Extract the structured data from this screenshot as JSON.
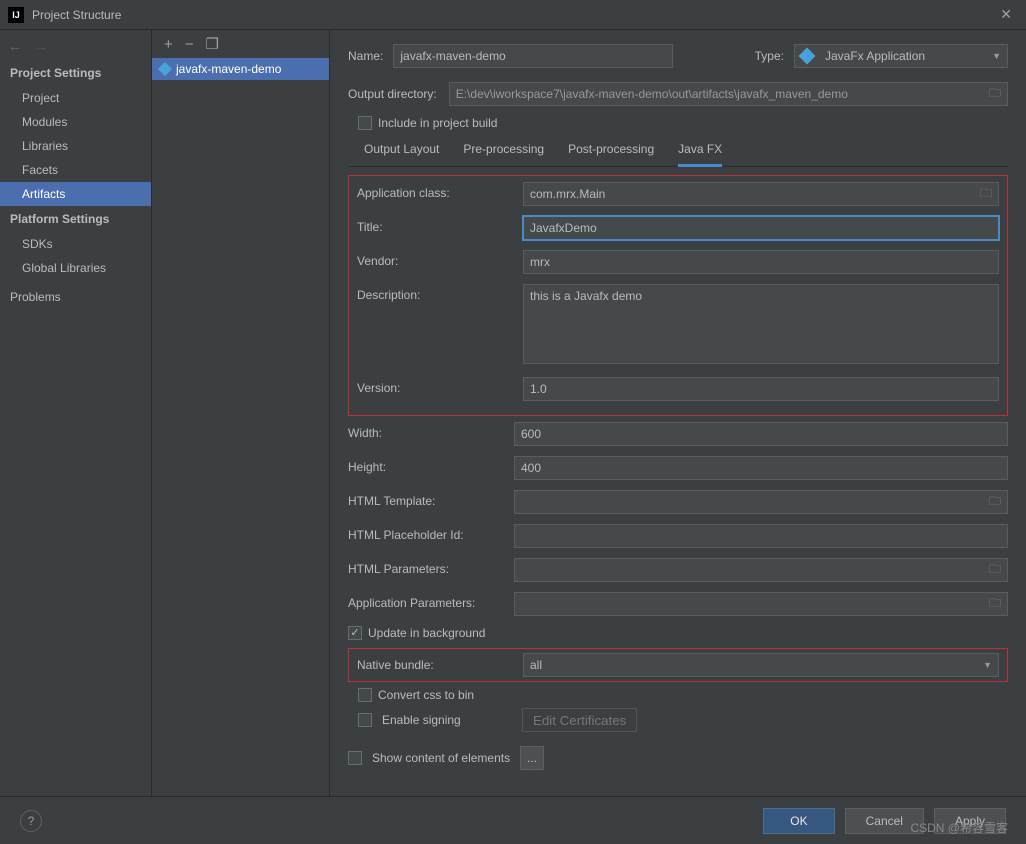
{
  "window": {
    "title": "Project Structure"
  },
  "sidebar": {
    "heading1": "Project Settings",
    "items1": [
      "Project",
      "Modules",
      "Libraries",
      "Facets",
      "Artifacts"
    ],
    "selected1": 4,
    "heading2": "Platform Settings",
    "items2": [
      "SDKs",
      "Global Libraries"
    ],
    "problems": "Problems"
  },
  "tree": {
    "item": "javafx-maven-demo"
  },
  "detail": {
    "name_label": "Name:",
    "name_value": "javafx-maven-demo",
    "type_label": "Type:",
    "type_value": "JavaFx Application",
    "out_label": "Output directory:",
    "out_value": "E:\\dev\\iworkspace7\\javafx-maven-demo\\out\\artifacts\\javafx_maven_demo",
    "include_label": "Include in project build",
    "tabs": [
      "Output Layout",
      "Pre-processing",
      "Post-processing",
      "Java FX"
    ],
    "active_tab": 3
  },
  "javafx": {
    "app_class_label": "Application class:",
    "app_class": "com.mrx.Main",
    "title_label": "Title:",
    "title": "JavafxDemo",
    "vendor_label": "Vendor:",
    "vendor": "mrx",
    "desc_label": "Description:",
    "desc": "this is a Javafx demo",
    "version_label": "Version:",
    "version": "1.0",
    "width_label": "Width:",
    "width": "600",
    "height_label": "Height:",
    "height": "400",
    "html_template_label": "HTML Template:",
    "html_placeholder_label": "HTML Placeholder Id:",
    "html_params_label": "HTML Parameters:",
    "app_params_label": "Application Parameters:",
    "update_bg_label": "Update in background",
    "native_bundle_label": "Native bundle:",
    "native_bundle": "all",
    "convert_css_label": "Convert css to bin",
    "enable_signing_label": "Enable signing",
    "edit_certs_label": "Edit Certificates",
    "show_content_label": "Show content of elements",
    "ellipsis": "..."
  },
  "buttons": {
    "ok": "OK",
    "cancel": "Cancel",
    "apply": "Apply"
  },
  "watermark": "CSDN @希容雪客"
}
